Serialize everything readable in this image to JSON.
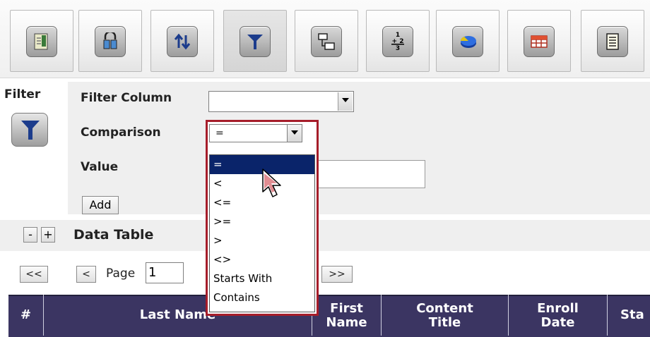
{
  "toolbar": {
    "buttons": [
      {
        "name": "report-icon"
      },
      {
        "name": "group-icon"
      },
      {
        "name": "sort-icon"
      },
      {
        "name": "filter-icon"
      },
      {
        "name": "flow-icon"
      },
      {
        "name": "fraction-icon",
        "top": "1",
        "bottom": "3",
        "mid": "+ 2"
      },
      {
        "name": "pie-chart-icon"
      },
      {
        "name": "table-icon"
      },
      {
        "name": "document-icon"
      }
    ]
  },
  "filter": {
    "title": "Filter",
    "column_label": "Filter Column",
    "column_value": "",
    "comparison_label": "Comparison",
    "comparison_value": "=",
    "value_label": "Value",
    "value_value": "",
    "add_label": "Add",
    "options": [
      "=",
      "<",
      "<=",
      ">=",
      ">",
      "<>",
      "Starts With",
      "Contains"
    ],
    "selected_index": 0
  },
  "data_table": {
    "collapse": "-",
    "expand": "+",
    "title": "Data Table"
  },
  "pager": {
    "first": "<<",
    "prev": "<",
    "page_label": "Page",
    "page_value": "1",
    "last": ">>"
  },
  "table": {
    "headers": {
      "num": "#",
      "last_name": "Last Name",
      "first_name_1": "First",
      "first_name_2": "Name",
      "content_1": "Content",
      "content_2": "Title",
      "enroll_1": "Enroll",
      "enroll_2": "Date",
      "status": "Sta"
    }
  },
  "colors": {
    "header_bg": "#3b3562",
    "highlight_border": "#a61d2a",
    "selected_item": "#0a246a",
    "panel_bg": "#efefef"
  }
}
